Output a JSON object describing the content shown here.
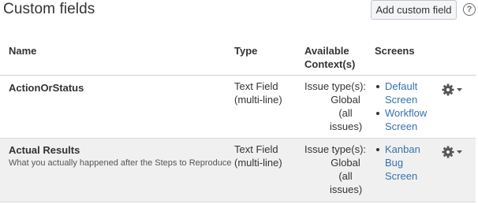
{
  "header": {
    "title": "Custom fields",
    "add_button": "Add custom field",
    "help_icon": "?"
  },
  "table": {
    "columns": {
      "name": "Name",
      "type": "Type",
      "context": "Available Context(s)",
      "screens": "Screens"
    },
    "rows": [
      {
        "name": "ActionOrStatus",
        "description": "",
        "type": "Text Field (multi-line)",
        "context_label": "Issue type(s):",
        "context_value": "Global (all issues)",
        "screens": [
          "Default Screen",
          "Workflow Screen"
        ],
        "actions_icon": "gear-icon"
      },
      {
        "name": "Actual Results",
        "description": "What you actually happened after the Steps to Reproduce",
        "type": "Text Field (multi-line)",
        "context_label": "Issue type(s):",
        "context_value": "Global (all issues)",
        "screens": [
          "Kanban Bug Screen"
        ],
        "actions_icon": "gear-icon"
      }
    ]
  },
  "colors": {
    "link": "#3572b0",
    "alt_row": "#f0f0f0",
    "text": "#333333"
  }
}
